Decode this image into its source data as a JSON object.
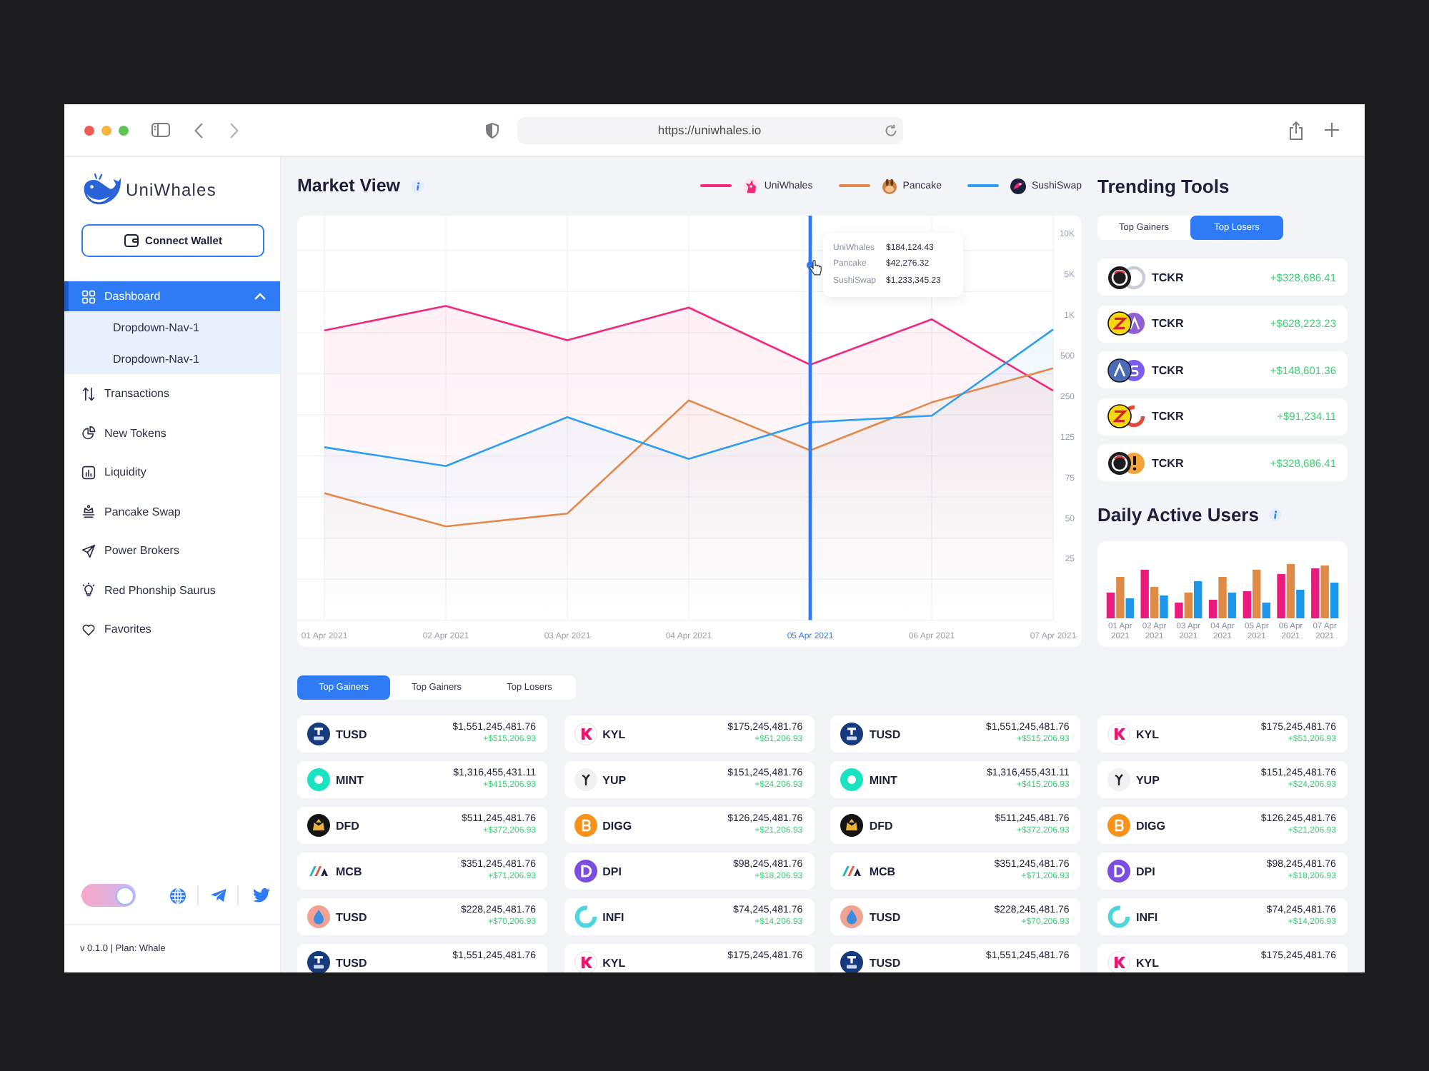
{
  "browser": {
    "url": "https://uniwhales.io"
  },
  "sidebar": {
    "logo_text": "UniWhales",
    "connect_button": "Connect Wallet",
    "items": [
      {
        "label": "Dashboard",
        "kind": "grid",
        "selected": true,
        "expanded": true,
        "children": [
          {
            "label": "Dropdown-Nav-1",
            "selected": false
          },
          {
            "label": "Dropdown-Nav-1",
            "selected": false
          }
        ]
      },
      {
        "label": "Transactions",
        "kind": "arrows",
        "selected": false
      },
      {
        "label": "New Tokens",
        "kind": "pie",
        "selected": false
      },
      {
        "label": "Liquidity",
        "kind": "bars",
        "selected": false
      },
      {
        "label": "Pancake Swap",
        "kind": "crown",
        "selected": false
      },
      {
        "label": "Power Brokers",
        "kind": "plane",
        "selected": false
      },
      {
        "label": "Red Phonship Saurus",
        "kind": "bulb",
        "selected": false
      },
      {
        "label": "Favorites",
        "kind": "heart",
        "selected": false
      }
    ],
    "theme_toggle": {
      "on": true
    },
    "version": "v 0.1.0 | Plan: Whale"
  },
  "market_view": {
    "title": "Market View",
    "legend": [
      {
        "name": "UniWhales",
        "color": "#f0297c"
      },
      {
        "name": "Pancake",
        "color": "#e28a4e"
      },
      {
        "name": "SushiSwap",
        "color": "#2d9ef0"
      }
    ],
    "y_axis_labels": [
      "10K",
      "5K",
      "1K",
      "500",
      "250",
      "125",
      "75",
      "50",
      "25"
    ],
    "x_axis_labels": [
      {
        "label": "01 Apr 2021",
        "hovered": false
      },
      {
        "label": "02 Apr 2021",
        "hovered": false
      },
      {
        "label": "03 Apr 2021",
        "hovered": false
      },
      {
        "label": "04 Apr 2021",
        "hovered": false
      },
      {
        "label": "05 Apr 2021",
        "hovered": true
      },
      {
        "label": "06 Apr 2021",
        "hovered": false
      },
      {
        "label": "07 Apr 2021",
        "hovered": false
      }
    ],
    "tooltip": [
      {
        "label": "UniWhales",
        "value": "$184,124.43"
      },
      {
        "label": "Pancake",
        "value": "$42,276.32"
      },
      {
        "label": "SushiSwap",
        "value": "$1,233,345.23"
      }
    ]
  },
  "trending_tools": {
    "title": "Trending Tools",
    "tabs": [
      {
        "label": "Top Gainers",
        "selected": false
      },
      {
        "label": "Top Losers",
        "selected": true
      }
    ],
    "rows": [
      {
        "kind": "tyre",
        "symbol": "TCKR",
        "change": "+$328,686.41"
      },
      {
        "kind": "bolt",
        "symbol": "TCKR",
        "change": "+$628,223.23"
      },
      {
        "kind": "delta",
        "symbol": "TCKR",
        "change": "+$148,601.36"
      },
      {
        "kind": "blaze",
        "symbol": "TCKR",
        "change": "+$91,234.11"
      },
      {
        "kind": "alert",
        "symbol": "TCKR",
        "change": "+$328,686.41"
      }
    ]
  },
  "daily_active_users": {
    "title": "Daily Active Users",
    "day_labels": [
      "01 Apr 2021",
      "02 Apr 2021",
      "03 Apr 2021",
      "04 Apr 2021",
      "05 Apr 2021",
      "06 Apr 2021",
      "07 Apr 2021"
    ]
  },
  "tokens": {
    "tabs": [
      {
        "label": "Top Gainers",
        "selected": true
      },
      {
        "label": "Top Gainers",
        "selected": false
      },
      {
        "label": "Top Losers",
        "selected": false
      }
    ],
    "cards": [
      {
        "kind": "shield",
        "symbol": "TUSD",
        "price": "$1,551,245,481.76",
        "change": "+$515,206.93"
      },
      {
        "kind": "kmark",
        "symbol": "KYL",
        "price": "$175,245,481.76",
        "change": "+$51,206.93"
      },
      {
        "kind": "shield",
        "symbol": "TUSD",
        "price": "$1,551,245,481.76",
        "change": "+$515,206.93"
      },
      {
        "kind": "kmark",
        "symbol": "KYL",
        "price": "$175,245,481.76",
        "change": "+$51,206.93"
      },
      {
        "kind": "ring",
        "symbol": "MINT",
        "price": "$1,316,455,431.11",
        "change": "+$415,206.93"
      },
      {
        "kind": "fork",
        "symbol": "YUP",
        "price": "$151,245,481.76",
        "change": "+$24,206.93"
      },
      {
        "kind": "ring",
        "symbol": "MINT",
        "price": "$1,316,455,431.11",
        "change": "+$415,206.93"
      },
      {
        "kind": "fork",
        "symbol": "YUP",
        "price": "$151,245,481.76",
        "change": "+$24,206.93"
      },
      {
        "kind": "crown",
        "symbol": "DFD",
        "price": "$511,245,481.76",
        "change": "+$372,206.93"
      },
      {
        "kind": "bcoin",
        "symbol": "DIGG",
        "price": "$126,245,481.76",
        "change": "+$21,206.93"
      },
      {
        "kind": "crown",
        "symbol": "DFD",
        "price": "$511,245,481.76",
        "change": "+$372,206.93"
      },
      {
        "kind": "bcoin",
        "symbol": "DIGG",
        "price": "$126,245,481.76",
        "change": "+$21,206.93"
      },
      {
        "kind": "stripes",
        "symbol": "MCB",
        "price": "$351,245,481.76",
        "change": "+$71,206.93"
      },
      {
        "kind": "dcoin",
        "symbol": "DPI",
        "price": "$98,245,481.76",
        "change": "+$18,206.93"
      },
      {
        "kind": "stripes",
        "symbol": "MCB",
        "price": "$351,245,481.76",
        "change": "+$71,206.93"
      },
      {
        "kind": "dcoin",
        "symbol": "DPI",
        "price": "$98,245,481.76",
        "change": "+$18,206.93"
      },
      {
        "kind": "drop",
        "symbol": "TUSD",
        "price": "$228,245,481.76",
        "change": "+$70,206.93"
      },
      {
        "kind": "loop",
        "symbol": "INFI",
        "price": "$74,245,481.76",
        "change": "+$14,206.93"
      },
      {
        "kind": "drop",
        "symbol": "TUSD",
        "price": "$228,245,481.76",
        "change": "+$70,206.93"
      },
      {
        "kind": "loop",
        "symbol": "INFI",
        "price": "$74,245,481.76",
        "change": "+$14,206.93"
      },
      {
        "kind": "shield",
        "symbol": "TUSD",
        "price": "$1,551,245,481.76"
      },
      {
        "kind": "kmark",
        "symbol": "KYL",
        "price": "$175,245,481.76"
      },
      {
        "kind": "shield",
        "symbol": "TUSD",
        "price": "$1,551,245,481.76"
      },
      {
        "kind": "kmark",
        "symbol": "KYL",
        "price": "$175,245,481.76"
      }
    ]
  }
}
